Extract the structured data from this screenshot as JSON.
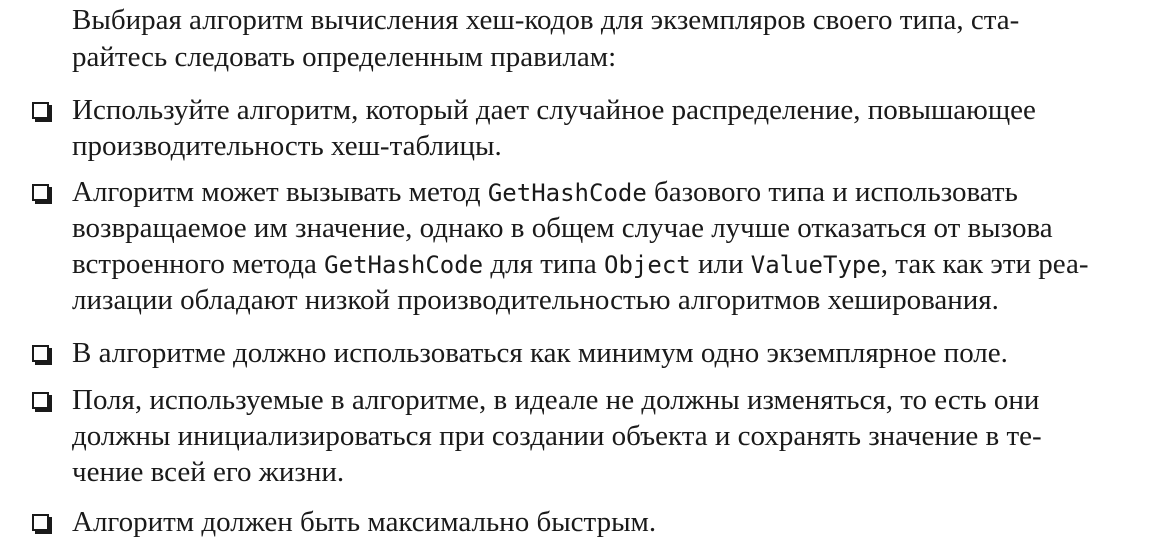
{
  "intro": {
    "line1": "Выбирая алгоритм вычисления хеш-кодов для экземпляров своего типа, ста-",
    "line2": "райтесь следовать определенным правилам:"
  },
  "items": [
    {
      "lines": [
        "Используйте алгоритм, который дает случайное распределение, повышающее",
        "производительность хеш-таблицы."
      ]
    },
    {
      "l1_a": "Алгоритм может вызывать метод ",
      "l1_code": "GetHashCode",
      "l1_b": " базового типа и использовать",
      "l2": "возвращаемое им значение, однако в общем случае лучше отказаться от вызова",
      "l3_a": "встроенного метода ",
      "l3_code1": "GetHashCode",
      "l3_b": " для типа ",
      "l3_code2": "Object",
      "l3_c": " или ",
      "l3_code3": "ValueType",
      "l3_d": ", так как эти реа-",
      "l4": "лизации обладают низкой производительностью алгоритмов хеширования."
    },
    {
      "lines": [
        "В алгоритме должно использоваться как минимум одно экземплярное поле."
      ]
    },
    {
      "lines": [
        "Поля, используемые в алгоритме, в идеале не должны изменяться, то есть они",
        "должны инициализироваться при создании объекта и сохранять значение в те-",
        "чение всей его жизни."
      ]
    },
    {
      "lines": [
        "Алгоритм должен быть максимально быстрым."
      ]
    }
  ],
  "icons": {
    "bullet": "checkbox-icon"
  }
}
